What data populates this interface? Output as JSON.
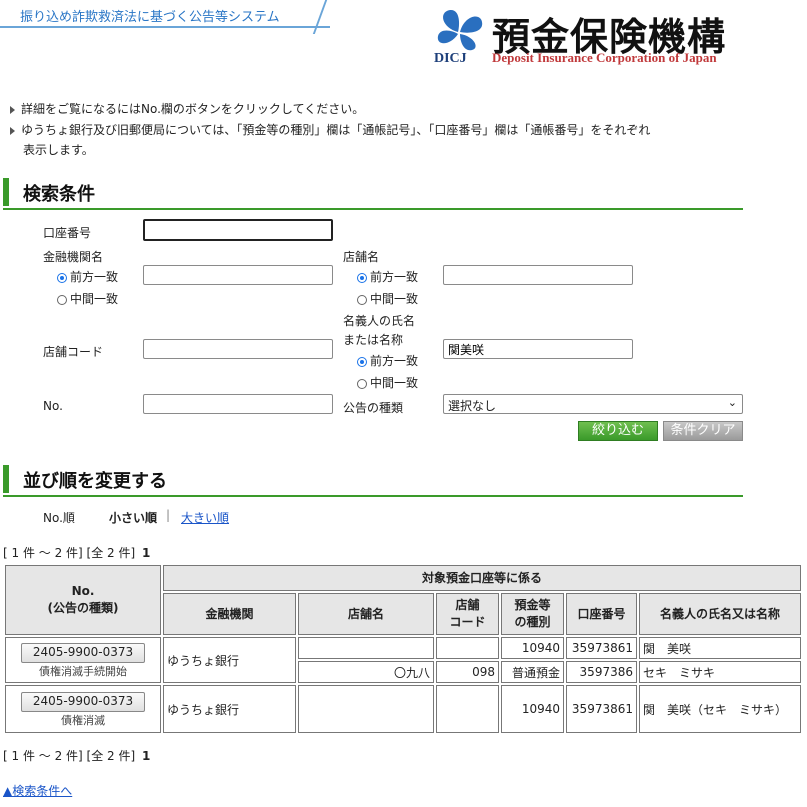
{
  "header": {
    "system_name": "振り込め詐欺救済法に基づく公告等システム",
    "logo_jp": "預金保険機構",
    "logo_en": "Deposit Insurance Corporation of Japan",
    "logo_abbr": "DICJ"
  },
  "notes": [
    "詳細をご覧になるにはNo.欄のボタンをクリックしてください。",
    "ゆうちょ銀行及び旧郵便局については、「預金等の種別」欄は「通帳記号」、「口座番号」欄は「通帳番号」をそれぞれ",
    "表示します。"
  ],
  "search": {
    "title": "検索条件",
    "account_label": "口座番号",
    "account_value": "",
    "bank_label": "金融機関名",
    "bank_value": "",
    "radio_prefix": "前方一致",
    "radio_middle": "中間一致",
    "branch_label": "店舗名",
    "branch_value": "",
    "holder_label_1": "名義人の氏名",
    "holder_label_2": "または名称",
    "holder_value": "関美咲",
    "branch_code_label": "店舗コード",
    "branch_code_value": "",
    "no_label": "No.",
    "no_value": "",
    "notice_type_label": "公告の種類",
    "notice_type_value": "選択なし",
    "filter_button": "絞り込む",
    "clear_button": "条件クリア"
  },
  "sort": {
    "title": "並び順を変更する",
    "field_label": "No.順",
    "asc_label": "小さい順",
    "separator": "|",
    "desc_label": "大きい順"
  },
  "paging": {
    "range_text": "[ 1 件 ～ 2 件] [全 2 件]",
    "current_page": "1"
  },
  "table": {
    "h_no_1": "No.",
    "h_no_2": "(公告の種類)",
    "h_group": "対象預金口座等に係る",
    "h_bank": "金融機関",
    "h_branch": "店舗名",
    "h_code_1": "店舗",
    "h_code_2": "コード",
    "h_type_1": "預金等",
    "h_type_2": "の種別",
    "h_account": "口座番号",
    "h_holder": "名義人の氏名又は名称",
    "rows": [
      {
        "no": "2405-9900-0373",
        "category": "債権消滅手続開始",
        "bank": "ゆうちょ銀行",
        "sub": [
          {
            "branch": "",
            "code": "",
            "type": "10940",
            "account": "35973861",
            "holder": "関　美咲"
          },
          {
            "branch": "〇九八",
            "code": "098",
            "type": "普通預金",
            "account": "3597386",
            "holder": "セキ　ミサキ"
          }
        ]
      },
      {
        "no": "2405-9900-0373",
        "category": "債権消滅",
        "bank": "ゆうちょ銀行",
        "sub": [
          {
            "branch": "",
            "code": "",
            "type": "10940",
            "account": "35973861",
            "holder": "関　美咲（セキ　ミサキ）"
          }
        ]
      }
    ]
  },
  "back_link": "▲検索条件へ",
  "colors": {
    "accent_green": "#3a9a2a",
    "banner_blue": "#2a76c6",
    "logo_red": "#c0393b",
    "link_blue": "#1a55c8"
  }
}
